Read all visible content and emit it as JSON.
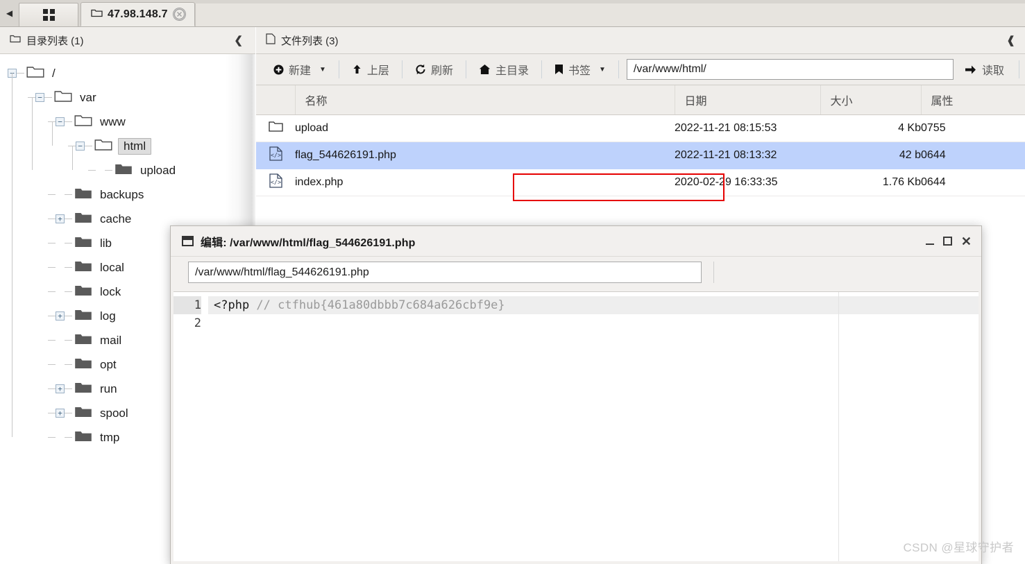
{
  "tabbar": {
    "scroll_left_icon": "chevron-left-icon",
    "grid_icon": "grid-icon",
    "active_tab": {
      "folder_icon": "folder-icon",
      "title": "47.98.148.7",
      "close_icon": "close-circle-icon"
    }
  },
  "tree_panel": {
    "header": {
      "folder_icon": "folder-icon",
      "title": "目录列表 (1)",
      "collapse_icon": "chevron-left-icon"
    },
    "nodes": [
      {
        "label": "/",
        "depth": 0,
        "toggle": "−",
        "open_folder": true,
        "selected": false
      },
      {
        "label": "var",
        "depth": 1,
        "toggle": "−",
        "open_folder": true,
        "selected": false
      },
      {
        "label": "www",
        "depth": 2,
        "toggle": "−",
        "open_folder": true,
        "selected": false
      },
      {
        "label": "html",
        "depth": 3,
        "toggle": "−",
        "open_folder": true,
        "selected": true
      },
      {
        "label": "upload",
        "depth": 4,
        "toggle": "",
        "open_folder": false,
        "selected": false
      },
      {
        "label": "backups",
        "depth": 2,
        "toggle": "",
        "open_folder": false,
        "selected": false
      },
      {
        "label": "cache",
        "depth": 2,
        "toggle": "+",
        "open_folder": false,
        "selected": false
      },
      {
        "label": "lib",
        "depth": 2,
        "toggle": "",
        "open_folder": false,
        "selected": false
      },
      {
        "label": "local",
        "depth": 2,
        "toggle": "",
        "open_folder": false,
        "selected": false
      },
      {
        "label": "lock",
        "depth": 2,
        "toggle": "",
        "open_folder": false,
        "selected": false
      },
      {
        "label": "log",
        "depth": 2,
        "toggle": "+",
        "open_folder": false,
        "selected": false
      },
      {
        "label": "mail",
        "depth": 2,
        "toggle": "",
        "open_folder": false,
        "selected": false
      },
      {
        "label": "opt",
        "depth": 2,
        "toggle": "",
        "open_folder": false,
        "selected": false
      },
      {
        "label": "run",
        "depth": 2,
        "toggle": "+",
        "open_folder": false,
        "selected": false
      },
      {
        "label": "spool",
        "depth": 2,
        "toggle": "+",
        "open_folder": false,
        "selected": false
      },
      {
        "label": "tmp",
        "depth": 2,
        "toggle": "",
        "open_folder": false,
        "selected": false
      }
    ]
  },
  "file_panel": {
    "header": {
      "file_icon": "file-icon",
      "title": "文件列表 (3)",
      "expand_icon": "chevron-up-icon"
    },
    "toolbar": {
      "new_label": "新建",
      "new_icon": "plus-circle-icon",
      "up_label": "上层",
      "up_icon": "arrow-up-icon",
      "refresh_label": "刷新",
      "refresh_icon": "refresh-icon",
      "home_label": "主目录",
      "home_icon": "home-icon",
      "bookmark_label": "书签",
      "bookmark_icon": "bookmark-icon",
      "path_value": "/var/www/html/",
      "read_label": "读取",
      "read_icon": "arrow-right-icon"
    },
    "columns": [
      "名称",
      "日期",
      "大小",
      "属性"
    ],
    "rows": [
      {
        "icon": "folder-icon",
        "name": "upload",
        "date": "2022-11-21 08:15:53",
        "size": "4 Kb",
        "attr": "0755",
        "selected": false,
        "highlighted": false
      },
      {
        "icon": "php-file-icon",
        "name": "flag_544626191.php",
        "date": "2022-11-21 08:13:32",
        "size": "42 b",
        "attr": "0644",
        "selected": true,
        "highlighted": true
      },
      {
        "icon": "php-file-icon",
        "name": "index.php",
        "date": "2020-02-29 16:33:35",
        "size": "1.76 Kb",
        "attr": "0644",
        "selected": false,
        "highlighted": false
      }
    ],
    "highlight_color": "#e60000",
    "selection_color": "#bed2fc"
  },
  "editor_dialog": {
    "window_icon": "window-icon",
    "title": "编辑: /var/www/html/flag_544626191.php",
    "minimize_icon": "minimize-icon",
    "maximize_icon": "maximize-icon",
    "close_icon": "close-icon",
    "path_value": "/var/www/html/flag_544626191.php",
    "lines": [
      {
        "number": "1",
        "code_keyword": "<?php ",
        "code_comment": "// ctfhub{461a80dbbb7c684a626cbf9e}",
        "active": true
      },
      {
        "number": "2",
        "code_keyword": "",
        "code_comment": "",
        "active": false
      }
    ]
  },
  "watermark": "CSDN @星球守护者"
}
